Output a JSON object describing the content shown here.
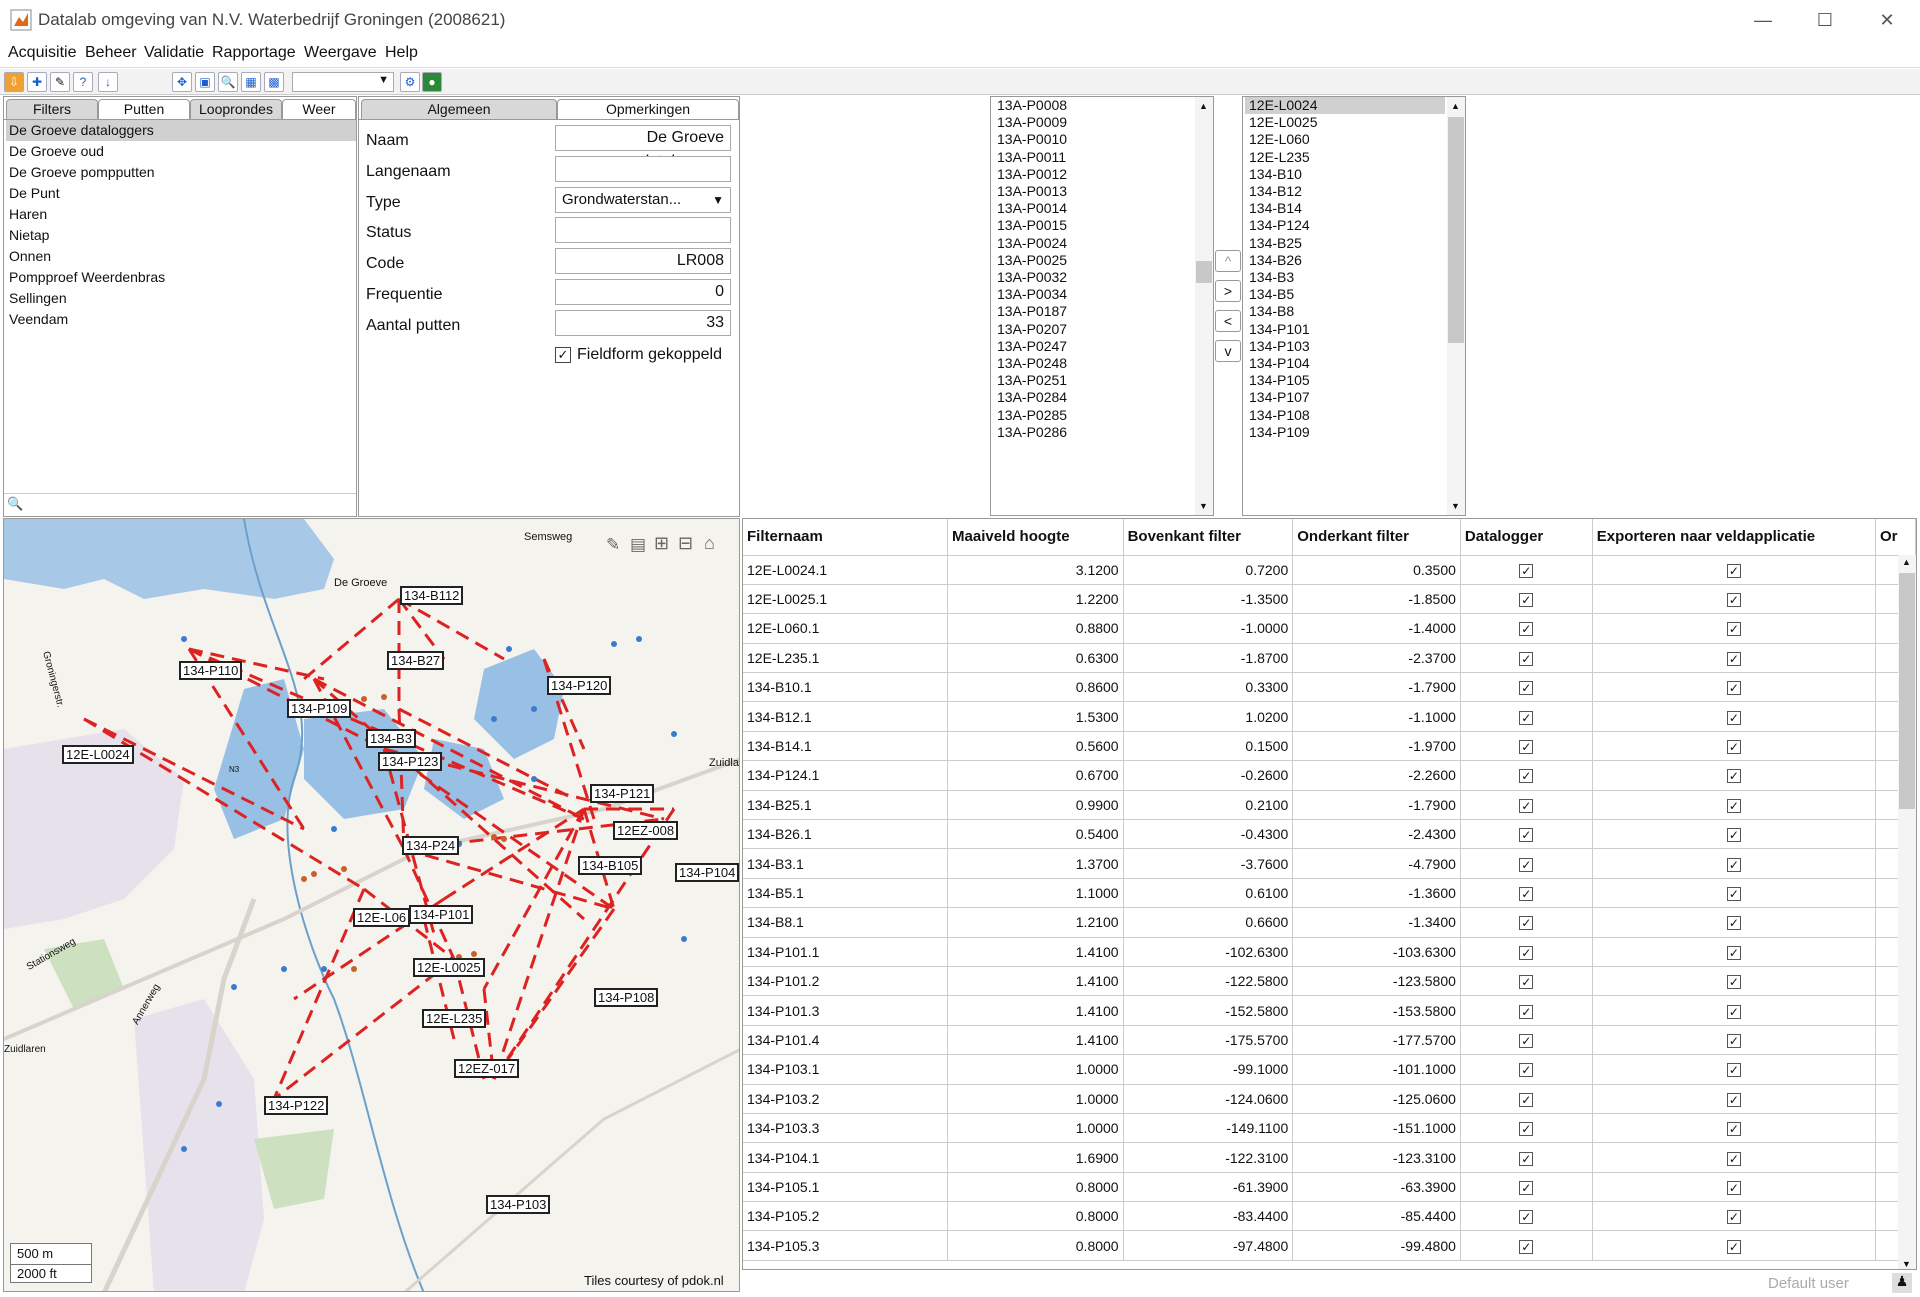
{
  "window": {
    "title": "Datalab omgeving van N.V. Waterbedrijf Groningen (2008621)"
  },
  "menu": [
    "Acquisitie",
    "Beheer",
    "Validatie",
    "Rapportage",
    "Weergave",
    "Help"
  ],
  "left": {
    "tabs": [
      "Filters",
      "Putten",
      "Looprondes",
      "Weer"
    ],
    "items": [
      "De Groeve dataloggers",
      "De Groeve oud",
      "De Groeve pompputten",
      "De Punt",
      "Haren",
      "Nietap",
      "Onnen",
      "Pompproef Weerdenbras",
      "Sellingen",
      "Veendam"
    ]
  },
  "form": {
    "tabs": [
      "Algemeen",
      "Opmerkingen"
    ],
    "fields": [
      {
        "label": "Naam",
        "value": "De Groeve dataloggers"
      },
      {
        "label": "Langenaam",
        "value": ""
      },
      {
        "label": "Type",
        "value": "Grondwaterstan..."
      },
      {
        "label": "Status",
        "value": ""
      },
      {
        "label": "Code",
        "value": "LR008"
      },
      {
        "label": "Frequentie",
        "value": "0"
      },
      {
        "label": "Aantal putten",
        "value": "33"
      }
    ],
    "checkbox_label": "Fieldform gekoppeld"
  },
  "available_list": [
    "13A-P0008",
    "13A-P0009",
    "13A-P0010",
    "13A-P0011",
    "13A-P0012",
    "13A-P0013",
    "13A-P0014",
    "13A-P0015",
    "13A-P0024",
    "13A-P0025",
    "13A-P0032",
    "13A-P0034",
    "13A-P0187",
    "13A-P0207",
    "13A-P0247",
    "13A-P0248",
    "13A-P0251",
    "13A-P0284",
    "13A-P0285",
    "13A-P0286"
  ],
  "move_buttons": [
    "^",
    ">",
    "<",
    "v"
  ],
  "selected_list": [
    "12E-L0024",
    "12E-L0025",
    "12E-L060",
    "12E-L235",
    "134-B10",
    "134-B12",
    "134-B14",
    "134-P124",
    "134-B25",
    "134-B26",
    "134-B3",
    "134-B5",
    "134-B8",
    "134-P101",
    "134-P103",
    "134-P104",
    "134-P105",
    "134-P107",
    "134-P108",
    "134-P109"
  ],
  "map": {
    "places": [
      "De Groeve",
      "Semsweg",
      "Zuidla",
      "Groningerstr.",
      "Stationsweg",
      "Zuidlaren",
      "Annerweg",
      "N3"
    ],
    "labels": [
      "134-B112",
      "134-P110",
      "134-B27",
      "134-P120",
      "134-P109",
      "134-B3",
      "12E-L0024",
      "134-P123",
      "134-P121",
      "12EZ-008",
      "134-P24",
      "134-B105",
      "134-P104",
      "12E-L06",
      "134-P101",
      "12E-L0025",
      "134-P108",
      "12E-L235",
      "12EZ-017",
      "134-P122",
      "134-P103"
    ],
    "scale_m": "500 m",
    "scale_ft": "2000 ft",
    "attribution": "Tiles courtesy of pdok.nl"
  },
  "table": {
    "headers": [
      "Filternaam",
      "Maaiveld hoogte",
      "Bovenkant filter",
      "Onderkant filter",
      "Datalogger",
      "Exporteren naar veldapplicatie",
      "Or"
    ],
    "rows": [
      [
        "12E-L0024.1",
        "3.1200",
        "0.7200",
        "0.3500"
      ],
      [
        "12E-L0025.1",
        "1.2200",
        "-1.3500",
        "-1.8500"
      ],
      [
        "12E-L060.1",
        "0.8800",
        "-1.0000",
        "-1.4000"
      ],
      [
        "12E-L235.1",
        "0.6300",
        "-1.8700",
        "-2.3700"
      ],
      [
        "134-B10.1",
        "0.8600",
        "0.3300",
        "-1.7900"
      ],
      [
        "134-B12.1",
        "1.5300",
        "1.0200",
        "-1.1000"
      ],
      [
        "134-B14.1",
        "0.5600",
        "0.1500",
        "-1.9700"
      ],
      [
        "134-P124.1",
        "0.6700",
        "-0.2600",
        "-2.2600"
      ],
      [
        "134-B25.1",
        "0.9900",
        "0.2100",
        "-1.7900"
      ],
      [
        "134-B26.1",
        "0.5400",
        "-0.4300",
        "-2.4300"
      ],
      [
        "134-B3.1",
        "1.3700",
        "-3.7600",
        "-4.7900"
      ],
      [
        "134-B5.1",
        "1.1000",
        "0.6100",
        "-1.3600"
      ],
      [
        "134-B8.1",
        "1.2100",
        "0.6600",
        "-1.3400"
      ],
      [
        "134-P101.1",
        "1.4100",
        "-102.6300",
        "-103.6300"
      ],
      [
        "134-P101.2",
        "1.4100",
        "-122.5800",
        "-123.5800"
      ],
      [
        "134-P101.3",
        "1.4100",
        "-152.5800",
        "-153.5800"
      ],
      [
        "134-P101.4",
        "1.4100",
        "-175.5700",
        "-177.5700"
      ],
      [
        "134-P103.1",
        "1.0000",
        "-99.1000",
        "-101.1000"
      ],
      [
        "134-P103.2",
        "1.0000",
        "-124.0600",
        "-125.0600"
      ],
      [
        "134-P103.3",
        "1.0000",
        "-149.1100",
        "-151.1000"
      ],
      [
        "134-P104.1",
        "1.6900",
        "-122.3100",
        "-123.3100"
      ],
      [
        "134-P105.1",
        "0.8000",
        "-61.3900",
        "-63.3900"
      ],
      [
        "134-P105.2",
        "0.8000",
        "-83.4400",
        "-85.4400"
      ],
      [
        "134-P105.3",
        "0.8000",
        "-97.4800",
        "-99.4800"
      ]
    ]
  },
  "status": {
    "user": "Default user"
  }
}
